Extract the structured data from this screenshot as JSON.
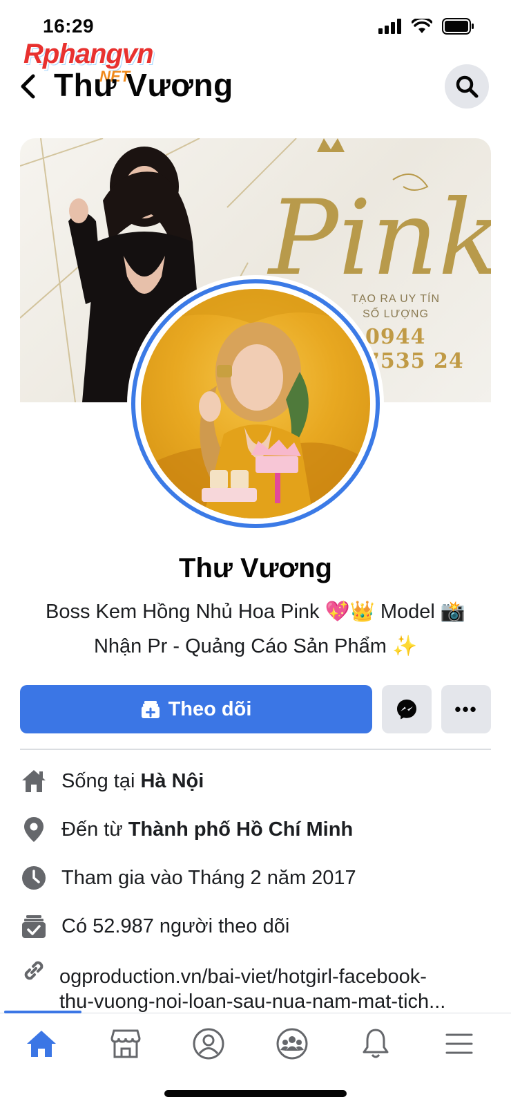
{
  "status_bar": {
    "time": "16:29"
  },
  "watermark": {
    "main": "Rphangvn",
    "suffix": ".NET"
  },
  "header": {
    "title": "Thư Vương"
  },
  "cover": {
    "script_text": "Pink",
    "slogan_line1": "TẠO RA UY TÍN",
    "slogan_line2": "SỐ LƯỢNG",
    "phone": "0944 7535 24"
  },
  "profile": {
    "name": "Thư Vương",
    "bio_line1": "Boss Kem Hồng Nhủ Hoa Pink 💖👑 Model 📸",
    "bio_line2": "Nhận Pr - Quảng Cáo Sản Phẩm ✨"
  },
  "actions": {
    "follow_label": "Theo dõi",
    "more_label": "•••"
  },
  "details": {
    "lives_prefix": "Sống tại ",
    "lives_value": "Hà Nội",
    "from_prefix": "Đến từ ",
    "from_value": "Thành phố Hồ Chí Minh",
    "joined": "Tham gia vào Tháng 2 năm 2017",
    "followers": "Có 52.987 người theo dõi",
    "link_line1": "ogproduction.vn/bai-viet/hotgirl-facebook-",
    "link_line2": "thu-vuong-noi-loan-sau-nua-nam-mat-tich..."
  },
  "tabbar": {
    "tabs": [
      "home-icon",
      "marketplace-icon",
      "profile-icon",
      "groups-icon",
      "notifications-icon",
      "menu-icon"
    ],
    "active": "home-icon"
  },
  "colors": {
    "accent": "#3b76e5",
    "button_gray": "#e4e6eb",
    "icon_gray": "#65676b"
  }
}
